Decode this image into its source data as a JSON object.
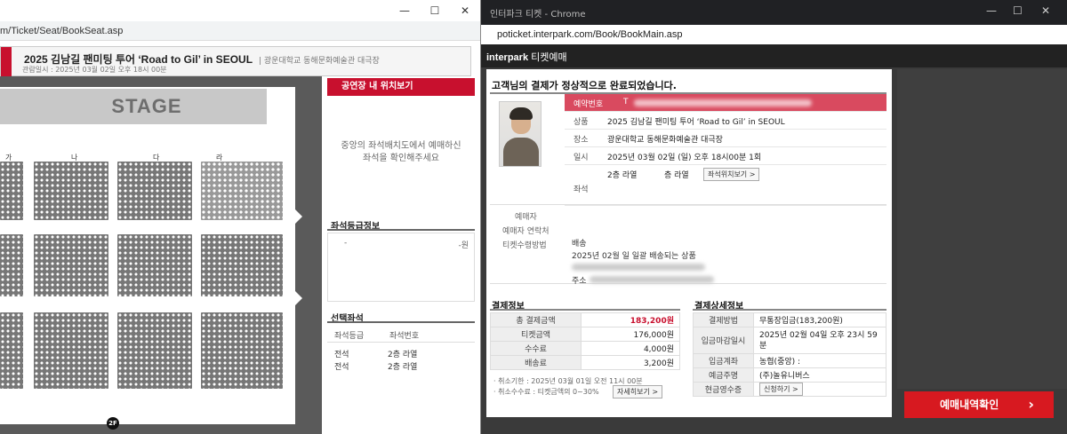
{
  "left": {
    "url": "m/Ticket/Seat/BookSeat.asp",
    "show_title": "2025 김남길 팬미팅 투어 ‘Road to Gil’ in SEOUL",
    "venue": "| 광운대학교 동해문화예술관 대극장",
    "date_line": "관람일시 : 2025년 03월 02일 오후 18시 00분",
    "stage": "STAGE",
    "sections": [
      "가",
      "나",
      "다",
      "라"
    ],
    "floor": "2F",
    "side": {
      "location_head": "공연장 내 위치보기",
      "location_msg": "중앙의 좌석배치도에서 예매하신 좌석을 확인해주세요",
      "grade_head": "좌석등급정보",
      "grade_dash": "-",
      "grade_price": "-원",
      "selected_head": "선택좌석",
      "col_grade": "좌석등급",
      "col_seatno": "좌석번호",
      "rows": [
        {
          "grade": "전석",
          "seat": "2층 라열"
        },
        {
          "grade": "전석",
          "seat": "2층 라열"
        }
      ]
    }
  },
  "right": {
    "tab_title": "인터파크 티켓 - Chrome",
    "url": "poticket.interpark.com/Book/BookMain.asp",
    "brand": "interpark",
    "brand_sub": "티켓예매",
    "result_title": "고객님의 결제가 정상적으로 완료되었습니다.",
    "reservation": {
      "no_label": "예약번호",
      "no_value": "T",
      "show_label": "상품",
      "show_value": "2025 김남길 팬미팅 투어 ‘Road to Gil’ in SEOUL",
      "place_label": "장소",
      "place_value": "광운대학교 동해문화예술관 대극장",
      "date_label": "일시",
      "date_value": "2025년 03월 02일 (일) 오후 18시00분 1회",
      "seat_label": "좌석",
      "seat_value_1": "2층 라열",
      "seat_value_2": "층 라열",
      "seat_btn": "좌석위치보기 >"
    },
    "buyer": {
      "name_label": "예매자",
      "contact_label": "예매자 연락처",
      "method_label": "티켓수령방법",
      "delivery": "배송",
      "delivery_note": "2025년 02월 일 일괄 배송되는 상품",
      "addr_label": "주소"
    },
    "payment": {
      "title": "결제정보",
      "total_label": "총 결제금액",
      "total_value": "183,200원",
      "ticket_label": "티켓금액",
      "ticket_value": "176,000원",
      "fee_label": "수수료",
      "fee_value": "4,000원",
      "ship_label": "배송료",
      "ship_value": "3,200원",
      "cancel_deadline": "· 취소기한 : 2025년 03월 01일 오전 11시 00분",
      "cancel_fee": "· 취소수수료 : 티켓금액의 0~30%",
      "detail_btn": "자세히보기 >"
    },
    "detail": {
      "title": "결제상세정보",
      "method_label": "결제방법",
      "method_value": "무통장입금(183,200원)",
      "due_label": "입금마감일시",
      "due_value": "2025년 02월 04일 오후 23시 59분",
      "account_label": "입금계좌",
      "account_value": "농협(중앙) :",
      "holder_label": "예금주명",
      "holder_value": "(주)놀유니버스",
      "receipt_label": "현금영수증",
      "receipt_btn": "신청하기 >"
    },
    "confirm_btn": "예매내역확인"
  }
}
